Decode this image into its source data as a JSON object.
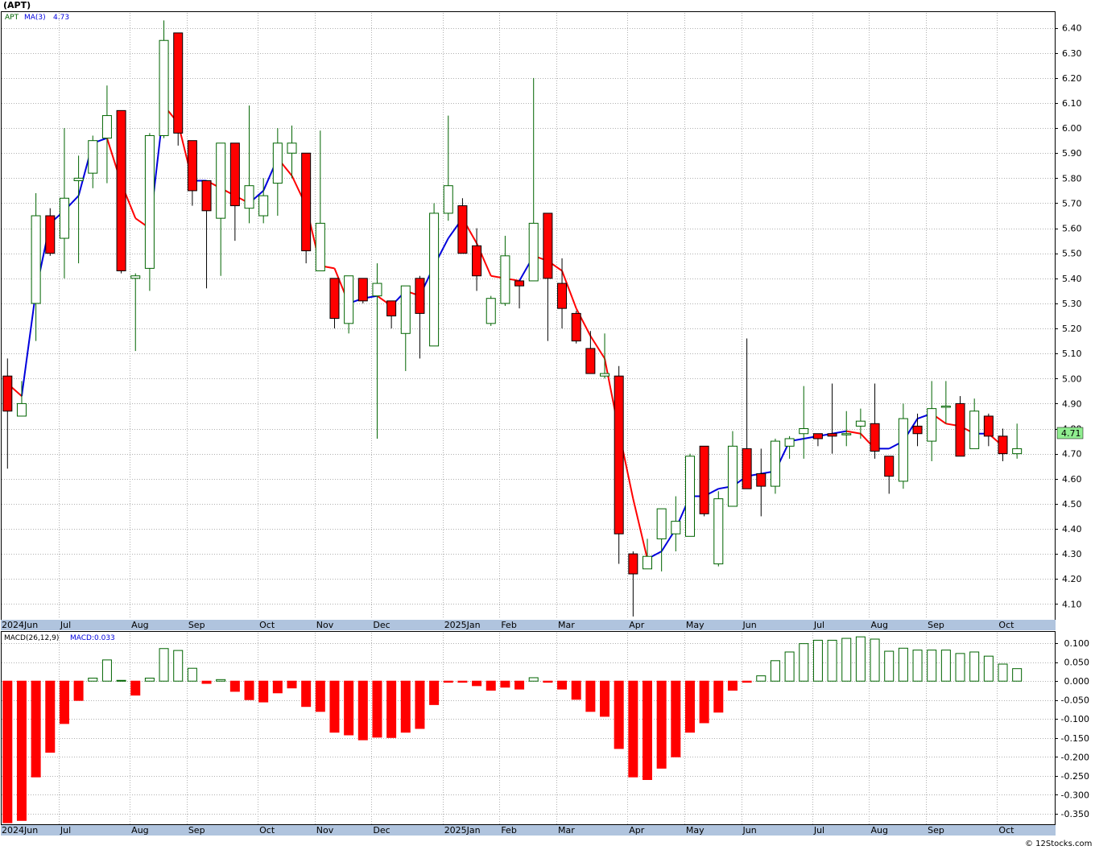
{
  "header": {
    "ticker": "(APT)"
  },
  "legend": {
    "symbol": "APT",
    "ma_label": "MA(3)",
    "ma_value": "4.73"
  },
  "macd_legend": {
    "label": "MACD(26,12,9)",
    "value_label": "MACD:0.033"
  },
  "footer": {
    "copyright": "© 12Stocks.com"
  },
  "last_price_label": "4.71",
  "colors": {
    "up": "#006400",
    "down": "#ff0000",
    "ma_up": "#0000dd",
    "ma_down": "#ff0000",
    "axis_bar": "#b0c4de",
    "grid": "#b0b0b0",
    "last_price_bg": "#90ee90"
  },
  "chart_data": [
    {
      "type": "candlestick",
      "title": "(APT)",
      "ylim": [
        4.04,
        6.46
      ],
      "y_ticks": [
        4.1,
        4.2,
        4.3,
        4.4,
        4.5,
        4.6,
        4.7,
        4.8,
        4.9,
        5.0,
        5.1,
        5.2,
        5.3,
        5.4,
        5.5,
        5.6,
        5.7,
        5.8,
        5.9,
        6.0,
        6.1,
        6.2,
        6.3,
        6.4
      ],
      "y_tick_labels": [
        "4.10",
        "4.20",
        "4.30",
        "4.40",
        "4.50",
        "4.60",
        "4.70",
        "4.80",
        "4.90",
        "5.00",
        "5.10",
        "5.20",
        "5.30",
        "5.40",
        "5.50",
        "5.60",
        "5.70",
        "5.80",
        "5.90",
        "6.00",
        "6.10",
        "6.20",
        "6.30",
        "6.40"
      ],
      "x_labels": [
        "2024Jun",
        "Jul",
        "Aug",
        "Sep",
        "Oct",
        "Nov",
        "Dec",
        "2025Jan",
        "Feb",
        "Mar",
        "Apr",
        "May",
        "Jun",
        "Jul",
        "Aug",
        "Sep",
        "Oct"
      ],
      "x_label_bars": [
        0,
        4,
        9,
        13,
        18,
        22,
        26,
        31,
        35,
        39,
        44,
        48,
        52,
        57,
        61,
        65,
        70
      ],
      "grid": true,
      "series": [
        {
          "name": "APT",
          "ohlc": [
            [
              5.01,
              5.08,
              4.64,
              4.87
            ],
            [
              4.85,
              4.99,
              4.85,
              4.9
            ],
            [
              5.3,
              5.74,
              5.15,
              5.65
            ],
            [
              5.65,
              5.68,
              5.49,
              5.5
            ],
            [
              5.56,
              6.0,
              5.4,
              5.72
            ],
            [
              5.79,
              5.89,
              5.46,
              5.8
            ],
            [
              5.82,
              5.97,
              5.76,
              5.95
            ],
            [
              5.96,
              6.17,
              5.78,
              6.05
            ],
            [
              6.07,
              6.07,
              5.42,
              5.43
            ],
            [
              5.4,
              5.42,
              5.11,
              5.41
            ],
            [
              5.44,
              5.98,
              5.35,
              5.97
            ],
            [
              5.97,
              6.43,
              5.96,
              6.35
            ],
            [
              6.38,
              6.38,
              5.93,
              5.98
            ],
            [
              5.95,
              5.95,
              5.69,
              5.75
            ],
            [
              5.79,
              5.79,
              5.36,
              5.67
            ],
            [
              5.64,
              5.94,
              5.41,
              5.94
            ],
            [
              5.94,
              5.94,
              5.55,
              5.69
            ],
            [
              5.68,
              6.09,
              5.62,
              5.77
            ],
            [
              5.65,
              5.8,
              5.62,
              5.73
            ],
            [
              5.78,
              6.0,
              5.65,
              5.94
            ],
            [
              5.9,
              6.01,
              5.8,
              5.94
            ],
            [
              5.9,
              5.9,
              5.46,
              5.51
            ],
            [
              5.43,
              5.99,
              5.46,
              5.62
            ],
            [
              5.4,
              5.4,
              5.2,
              5.24
            ],
            [
              5.22,
              5.41,
              5.18,
              5.41
            ],
            [
              5.4,
              5.4,
              5.3,
              5.31
            ],
            [
              5.33,
              5.46,
              4.76,
              5.38
            ],
            [
              5.31,
              5.31,
              5.2,
              5.25
            ],
            [
              5.18,
              5.37,
              5.03,
              5.37
            ],
            [
              5.4,
              5.41,
              5.08,
              5.26
            ],
            [
              5.13,
              5.7,
              5.13,
              5.66
            ],
            [
              5.66,
              6.05,
              5.63,
              5.77
            ],
            [
              5.69,
              5.72,
              5.51,
              5.5
            ],
            [
              5.53,
              5.6,
              5.35,
              5.41
            ],
            [
              5.22,
              5.33,
              5.21,
              5.32
            ],
            [
              5.3,
              5.57,
              5.29,
              5.49
            ],
            [
              5.39,
              5.39,
              5.28,
              5.37
            ],
            [
              5.39,
              6.2,
              5.39,
              5.62
            ],
            [
              5.66,
              5.66,
              5.15,
              5.4
            ],
            [
              5.38,
              5.48,
              5.2,
              5.28
            ],
            [
              5.26,
              5.27,
              5.14,
              5.15
            ],
            [
              5.12,
              5.19,
              5.03,
              5.02
            ],
            [
              5.01,
              5.18,
              5.0,
              5.02
            ],
            [
              5.01,
              5.05,
              4.26,
              4.38
            ],
            [
              4.3,
              4.31,
              4.05,
              4.22
            ],
            [
              4.24,
              4.36,
              4.24,
              4.29
            ],
            [
              4.36,
              4.47,
              4.23,
              4.48
            ],
            [
              4.38,
              4.53,
              4.31,
              4.43
            ],
            [
              4.37,
              4.7,
              4.37,
              4.69
            ],
            [
              4.73,
              4.73,
              4.45,
              4.46
            ],
            [
              4.26,
              4.55,
              4.25,
              4.52
            ],
            [
              4.49,
              4.79,
              4.49,
              4.73
            ],
            [
              4.72,
              5.16,
              4.56,
              4.56
            ],
            [
              4.62,
              4.72,
              4.45,
              4.57
            ],
            [
              4.57,
              4.76,
              4.54,
              4.75
            ],
            [
              4.73,
              4.77,
              4.68,
              4.76
            ],
            [
              4.78,
              4.97,
              4.68,
              4.8
            ],
            [
              4.78,
              4.78,
              4.73,
              4.76
            ],
            [
              4.78,
              4.98,
              4.7,
              4.77
            ],
            [
              4.78,
              4.87,
              4.73,
              4.78
            ],
            [
              4.81,
              4.88,
              4.76,
              4.83
            ],
            [
              4.82,
              4.98,
              4.68,
              4.71
            ],
            [
              4.69,
              4.69,
              4.54,
              4.61
            ],
            [
              4.59,
              4.9,
              4.56,
              4.84
            ],
            [
              4.81,
              4.86,
              4.73,
              4.78
            ],
            [
              4.75,
              4.99,
              4.67,
              4.88
            ],
            [
              4.89,
              4.99,
              4.82,
              4.89
            ],
            [
              4.9,
              4.93,
              4.69,
              4.69
            ],
            [
              4.72,
              4.92,
              4.72,
              4.87
            ],
            [
              4.85,
              4.86,
              4.73,
              4.77
            ],
            [
              4.77,
              4.8,
              4.67,
              4.7
            ],
            [
              4.7,
              4.82,
              4.68,
              4.72
            ]
          ]
        },
        {
          "name": "MA(3)",
          "values": [
            4.98,
            4.93,
            5.35,
            5.62,
            5.67,
            5.73,
            5.94,
            5.96,
            5.78,
            5.64,
            5.6,
            6.09,
            6.02,
            5.79,
            5.79,
            5.76,
            5.73,
            5.7,
            5.75,
            5.88,
            5.81,
            5.69,
            5.45,
            5.44,
            5.3,
            5.32,
            5.33,
            5.29,
            5.35,
            5.33,
            5.45,
            5.56,
            5.64,
            5.54,
            5.41,
            5.4,
            5.39,
            5.49,
            5.47,
            5.43,
            5.28,
            5.17,
            5.08,
            4.79,
            4.52,
            4.28,
            4.31,
            4.4,
            4.53,
            4.53,
            4.56,
            4.57,
            4.61,
            4.62,
            4.63,
            4.75,
            4.76,
            4.77,
            4.78,
            4.79,
            4.78,
            4.72,
            4.72,
            4.75,
            4.84,
            4.86,
            4.82,
            4.81,
            4.78,
            4.78,
            4.73
          ]
        }
      ]
    },
    {
      "type": "bar",
      "title": "MACD(26,12,9)",
      "ylim": [
        -0.378,
        0.128
      ],
      "y_ticks": [
        0.1,
        0.05,
        0.0,
        -0.05,
        -0.1,
        -0.15,
        -0.2,
        -0.25,
        -0.3,
        -0.35
      ],
      "y_tick_labels": [
        "0.100",
        "0.050",
        "0.000",
        "-0.050",
        "-0.100",
        "-0.150",
        "-0.200",
        "-0.250",
        "-0.300",
        "-0.350"
      ],
      "x_labels": [
        "2024Jun",
        "Jul",
        "Aug",
        "Sep",
        "Oct",
        "Nov",
        "Dec",
        "2025Jan",
        "Feb",
        "Mar",
        "Apr",
        "May",
        "Jun",
        "Jul",
        "Aug",
        "Sep",
        "Oct"
      ],
      "series": [
        {
          "name": "MACD:0.033",
          "values": [
            -0.374,
            -0.368,
            -0.253,
            -0.188,
            -0.112,
            -0.051,
            0.008,
            0.056,
            0.002,
            -0.037,
            0.008,
            0.086,
            0.081,
            0.034,
            -0.006,
            0.004,
            -0.027,
            -0.049,
            -0.055,
            -0.031,
            -0.018,
            -0.067,
            -0.08,
            -0.135,
            -0.142,
            -0.155,
            -0.148,
            -0.149,
            -0.135,
            -0.125,
            -0.062,
            -0.003,
            -0.003,
            -0.012,
            -0.024,
            -0.016,
            -0.021,
            0.009,
            -0.003,
            -0.021,
            -0.048,
            -0.08,
            -0.093,
            -0.178,
            -0.253,
            -0.26,
            -0.23,
            -0.2,
            -0.135,
            -0.11,
            -0.082,
            -0.024,
            -0.003,
            0.014,
            0.054,
            0.077,
            0.099,
            0.108,
            0.108,
            0.113,
            0.117,
            0.111,
            0.079,
            0.087,
            0.082,
            0.082,
            0.082,
            0.073,
            0.077,
            0.066,
            0.045,
            0.033
          ]
        }
      ]
    }
  ]
}
